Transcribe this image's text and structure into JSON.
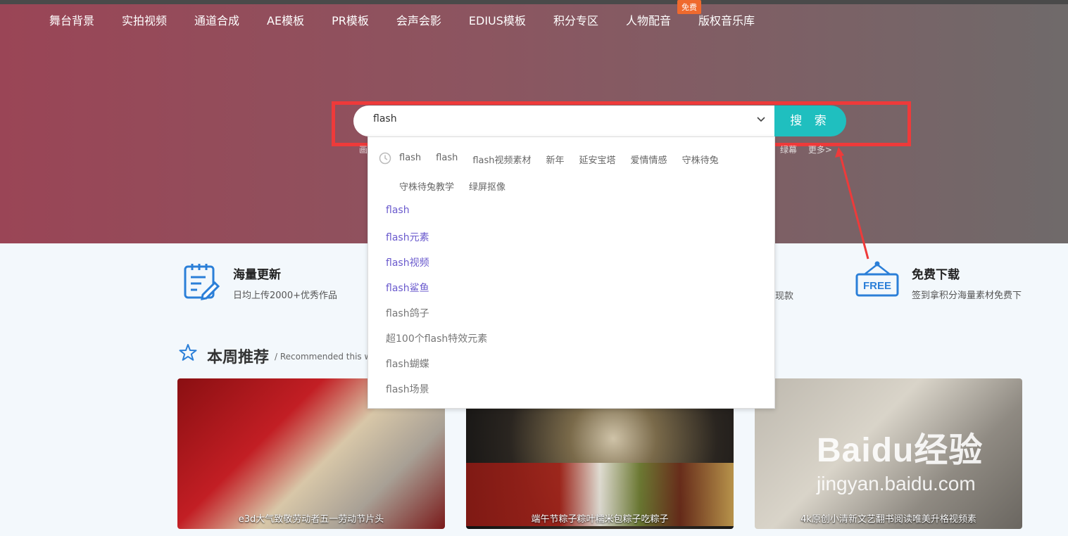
{
  "nav": {
    "items": [
      "舞台背景",
      "实拍视频",
      "通道合成",
      "AE模板",
      "PR模板",
      "会声会影",
      "EDIUS模板",
      "积分专区",
      "人物配音",
      "版权音乐库"
    ],
    "badge": "免费"
  },
  "search": {
    "value": "flash",
    "button_label": "搜 索",
    "hot_left": "画",
    "hot_right": [
      "绿幕",
      "更多>"
    ]
  },
  "dropdown": {
    "history": [
      "flash",
      "flash",
      "flash视频素材",
      "新年",
      "延安宝塔",
      "爱情情感",
      "守株待兔",
      "守株待兔教学",
      "绿屏抠像"
    ],
    "suggestions": [
      "flash",
      "flash元素",
      "flash视频",
      "flash鲨鱼",
      "flash鸽子",
      "超100个flash特效元素",
      "flash蝴蝶",
      "flash场景"
    ]
  },
  "features": [
    {
      "title": "海量更新",
      "desc": "日均上传2000+优秀作品",
      "icon": "clipboard-edit-icon"
    },
    {
      "desc_fragment": "现款"
    },
    {
      "title": "免费下载",
      "desc": "签到拿积分海量素材免费下",
      "icon": "free-sign-icon",
      "icon_label": "FREE"
    }
  ],
  "recommend": {
    "title": "本周推荐",
    "subtitle": "/ Recommended this w"
  },
  "cards": [
    {
      "caption": "e3d大气致敬劳动者五一劳动节片头"
    },
    {
      "caption": "端午节粽子粽叶糯米包粽子吃粽子"
    },
    {
      "caption": "4k原创小清新文艺翻书阅读唯美升格视频素"
    }
  ],
  "watermark": {
    "brand": "Baidu经验",
    "url": "jingyan.baidu.com"
  },
  "colors": {
    "accent": "#1fbfbf",
    "highlight": "#ee3a3a",
    "badge": "#ef6a2e"
  }
}
